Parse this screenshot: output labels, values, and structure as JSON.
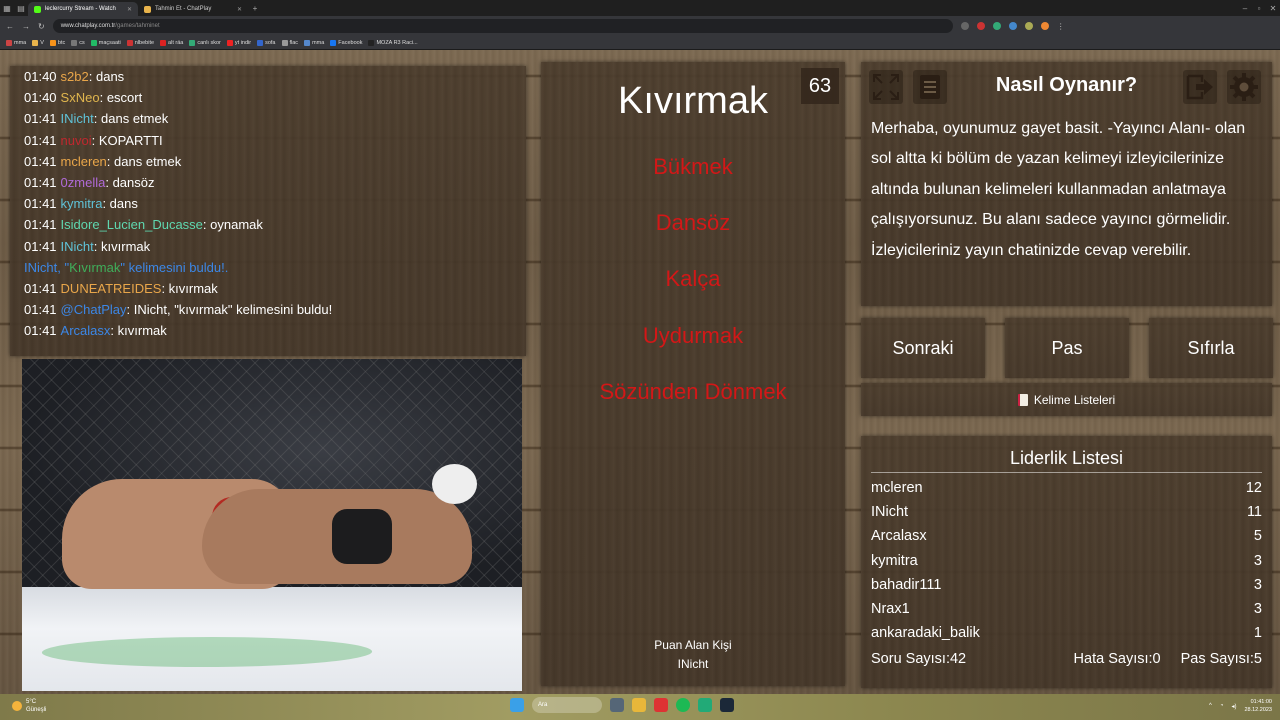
{
  "browser": {
    "tabs": [
      {
        "title": "leclercurry Stream - Watch",
        "active": true
      },
      {
        "title": "Tahmin Et - ChatPlay",
        "active": false
      }
    ],
    "url_host": "www.chatplay.com.tr",
    "url_path": "/games/tahminet",
    "bookmarks": [
      "mma",
      "V",
      "btc",
      "cs",
      "maçsaati",
      "nlbebite",
      "alt räa",
      "canlı skor",
      "yt indir",
      "sofa",
      "flac",
      "mma",
      "Facebook",
      "MOZA R3 Raci..."
    ]
  },
  "chat": {
    "lines": [
      {
        "time": "01:40",
        "user": "s2b2",
        "color": "#e9a64a",
        "text": "dans"
      },
      {
        "time": "01:40",
        "user": "SxNeo",
        "color": "#e0b64e",
        "text": "escort"
      },
      {
        "time": "01:41",
        "user": "INicht",
        "color": "#5fc3d8",
        "text": "dans etmek"
      },
      {
        "time": "01:41",
        "user": "nuvoi",
        "color": "#c0282e",
        "text": "KOPARTTI"
      },
      {
        "time": "01:41",
        "user": "mcleren",
        "color": "#e9a64a",
        "text": "dans etmek"
      },
      {
        "time": "01:41",
        "user": "0zmella",
        "color": "#b06ad8",
        "text": "dansöz"
      },
      {
        "time": "01:41",
        "user": "kymitra",
        "color": "#5fc3d8",
        "text": "dans"
      },
      {
        "time": "01:41",
        "user": "Isidore_Lucien_Ducasse",
        "color": "#5fd8b0",
        "text": "oynamak"
      },
      {
        "time": "01:41",
        "user": "INicht",
        "color": "#5fc3d8",
        "text": "kıvırmak"
      },
      {
        "time": "",
        "user": "",
        "color": "",
        "text": "",
        "system": true,
        "pre": "INicht, \"",
        "word": "Kıvırmak",
        "post": "\" kelimesini buldu!."
      },
      {
        "time": "01:41",
        "user": "DUNEATREIDES",
        "color": "#e9a64a",
        "text": "kıvırmak"
      },
      {
        "time": "01:41",
        "user": "@ChatPlay",
        "color": "#3c87e6",
        "text": "INicht, \"kıvırmak\" kelimesini buldu!"
      },
      {
        "time": "01:41",
        "user": "Arcalasx",
        "color": "#3c87e6",
        "text": "kıvırmak"
      }
    ]
  },
  "game": {
    "counter": "63",
    "word": "Kıvırmak",
    "taboo_words": [
      "Bükmek",
      "Dansöz",
      "Kalça",
      "Uydurmak",
      "Sözünden Dönmek"
    ],
    "scorer_label": "Puan Alan Kişi",
    "scorer_name": "INicht"
  },
  "help": {
    "title": "Nasıl Oynanır?",
    "text": "Merhaba, oyunumuz gayet basit. -Yayıncı Alanı- olan sol altta ki bölüm de yazan kelimeyi izleyicilerinize altında bulunan kelimeleri kullanmadan anlatmaya çalışıyorsunuz. Bu alanı sadece yayıncı görmelidir. İzleyicileriniz yayın chatinizde cevap verebilir."
  },
  "controls": {
    "next": "Sonraki",
    "pass": "Pas",
    "reset": "Sıfırla",
    "word_lists": "Kelime Listeleri"
  },
  "leaderboard": {
    "title": "Liderlik Listesi",
    "rows": [
      {
        "name": "mcleren",
        "score": "12"
      },
      {
        "name": "INicht",
        "score": "11"
      },
      {
        "name": "Arcalasx",
        "score": "5"
      },
      {
        "name": "kymitra",
        "score": "3"
      },
      {
        "name": "bahadir111",
        "score": "3"
      },
      {
        "name": "Nrax1",
        "score": "3"
      },
      {
        "name": "ankaradaki_balik",
        "score": "1"
      }
    ],
    "question_count_label": "Soru Sayısı:42",
    "error_count_label": "Hata Sayısı:0",
    "pass_count_label": "Pas Sayısı:5"
  },
  "taskbar": {
    "weather_temp": "5°C",
    "weather_desc": "Güneşli",
    "search": "Ara",
    "time": "01:41:00",
    "date": "28.12.2023"
  }
}
